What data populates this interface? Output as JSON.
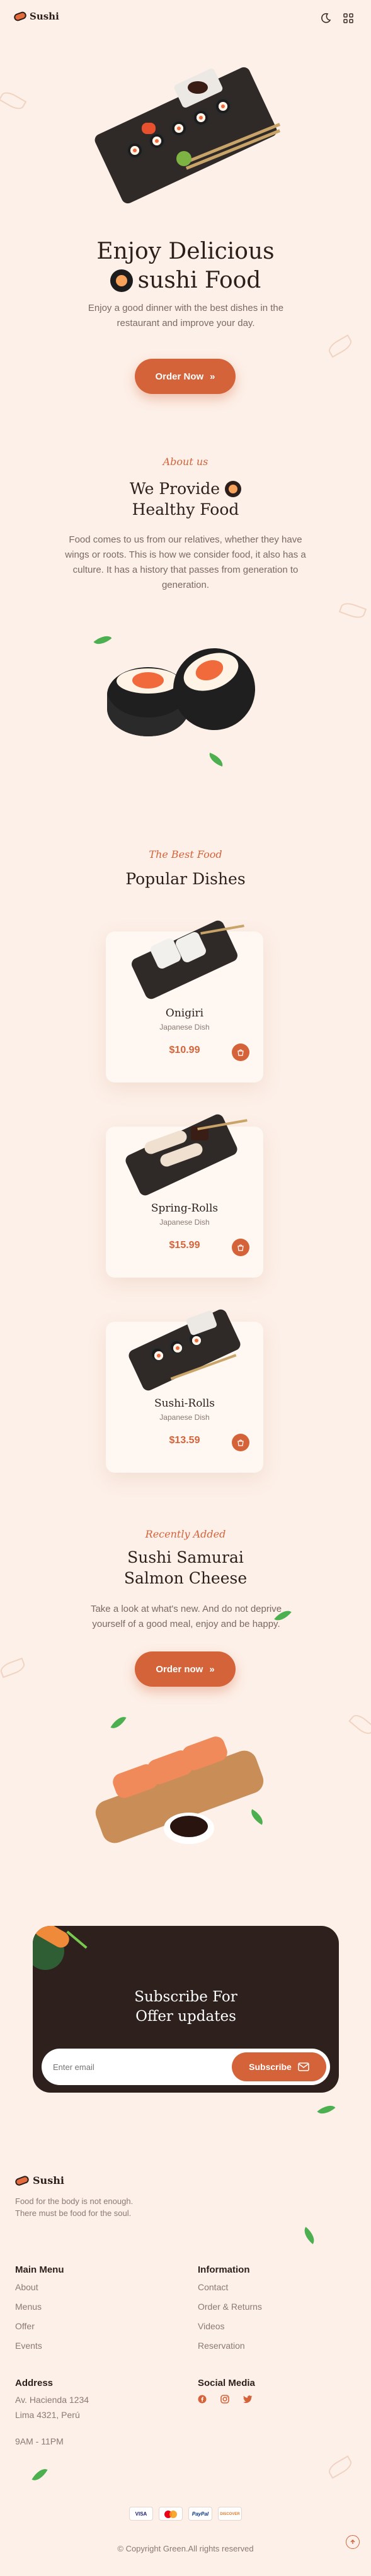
{
  "header": {
    "brand": "Sushi"
  },
  "hero": {
    "title_line1": "Enjoy Delicious",
    "title_line2": "sushi Food",
    "description": "Enjoy a good dinner with the best dishes in the restaurant and improve your day.",
    "button": "Order Now"
  },
  "about": {
    "tag": "About us",
    "title_line1": "We Provide",
    "title_line2": "Healthy Food",
    "description": "Food comes to us from our relatives, whether they have wings or roots. This is how we consider food, it also has a culture. It has a history that passes from generation to generation."
  },
  "popular": {
    "tag": "The Best Food",
    "title": "Popular Dishes",
    "dishes": [
      {
        "name": "Onigiri",
        "category": "Japanese Dish",
        "price": "$10.99"
      },
      {
        "name": "Spring-Rolls",
        "category": "Japanese Dish",
        "price": "$15.99"
      },
      {
        "name": "Sushi-Rolls",
        "category": "Japanese Dish",
        "price": "$13.59"
      }
    ]
  },
  "recent": {
    "tag": "Recently Added",
    "title_line1": "Sushi Samurai",
    "title_line2": "Salmon Cheese",
    "description": "Take a look at what's new. And do not deprive yourself of a good meal, enjoy and be happy.",
    "button": "Order now"
  },
  "subscribe": {
    "title_line1": "Subscribe For",
    "title_line2": "Offer updates",
    "placeholder": "Enter email",
    "button": "Subscribe"
  },
  "footer": {
    "brand": "Sushi",
    "tagline": "Food for the body is not enough. There must be food for the soul.",
    "main_menu": {
      "title": "Main Menu",
      "items": [
        "About",
        "Menus",
        "Offer",
        "Events"
      ]
    },
    "information": {
      "title": "Information",
      "items": [
        "Contact",
        "Order & Returns",
        "Videos",
        "Reservation"
      ]
    },
    "address": {
      "title": "Address",
      "line1": "Av. Hacienda 1234",
      "line2": "Lima 4321, Perú",
      "hours": "9AM - 11PM"
    },
    "social": {
      "title": "Social Media"
    },
    "payments": [
      "VISA",
      "MC",
      "PayPal",
      "DISCOVER"
    ],
    "copyright": "© Copyright Green.All rights reserved"
  },
  "colors": {
    "accent": "#d4633a",
    "background": "#fdf0e8",
    "dark": "#2e201c"
  }
}
